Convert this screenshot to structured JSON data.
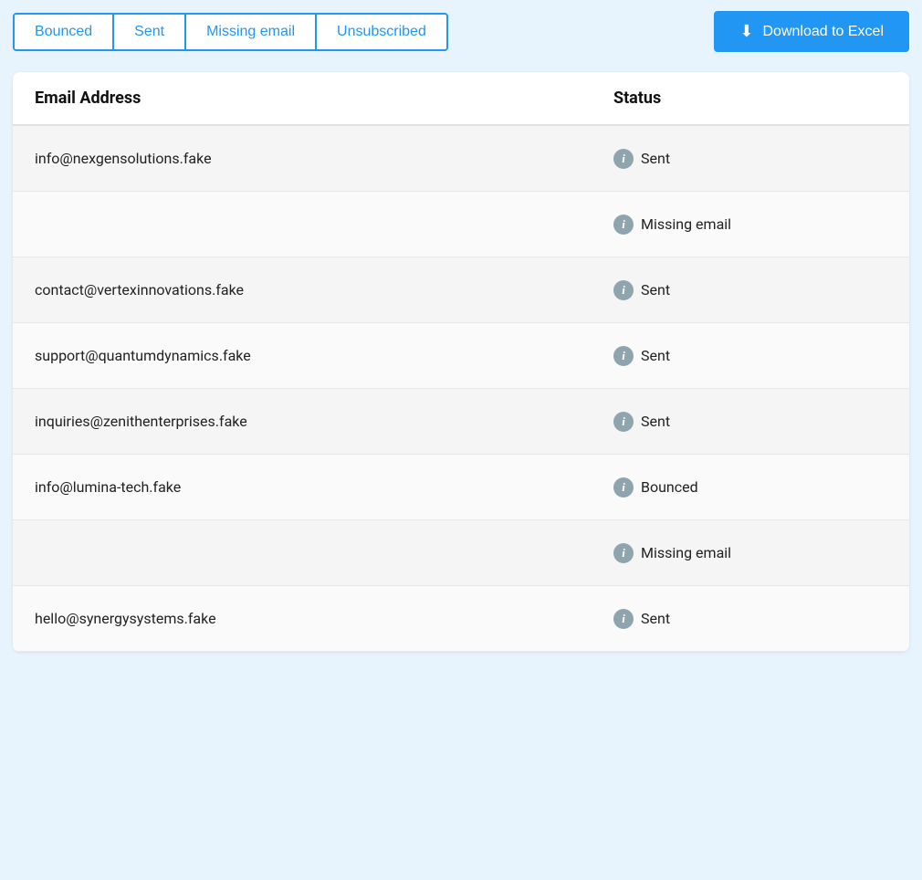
{
  "tabs": [
    {
      "label": "Bounced",
      "active": true
    },
    {
      "label": "Sent",
      "active": false
    },
    {
      "label": "Missing email",
      "active": false
    },
    {
      "label": "Unsubscribed",
      "active": false
    }
  ],
  "download_button": {
    "label": "Download to Excel",
    "icon": "⬇"
  },
  "table": {
    "col_email_header": "Email Address",
    "col_status_header": "Status",
    "rows": [
      {
        "email": "info@nexgensolutions.fake",
        "status": "Sent"
      },
      {
        "email": "",
        "status": "Missing email"
      },
      {
        "email": "contact@vertexinnovations.fake",
        "status": "Sent"
      },
      {
        "email": "support@quantumdynamics.fake",
        "status": "Sent"
      },
      {
        "email": "inquiries@zenithenterprises.fake",
        "status": "Sent"
      },
      {
        "email": "info@lumina-tech.fake",
        "status": "Bounced"
      },
      {
        "email": "",
        "status": "Missing email"
      },
      {
        "email": "hello@synergysystems.fake",
        "status": "Sent"
      }
    ]
  }
}
